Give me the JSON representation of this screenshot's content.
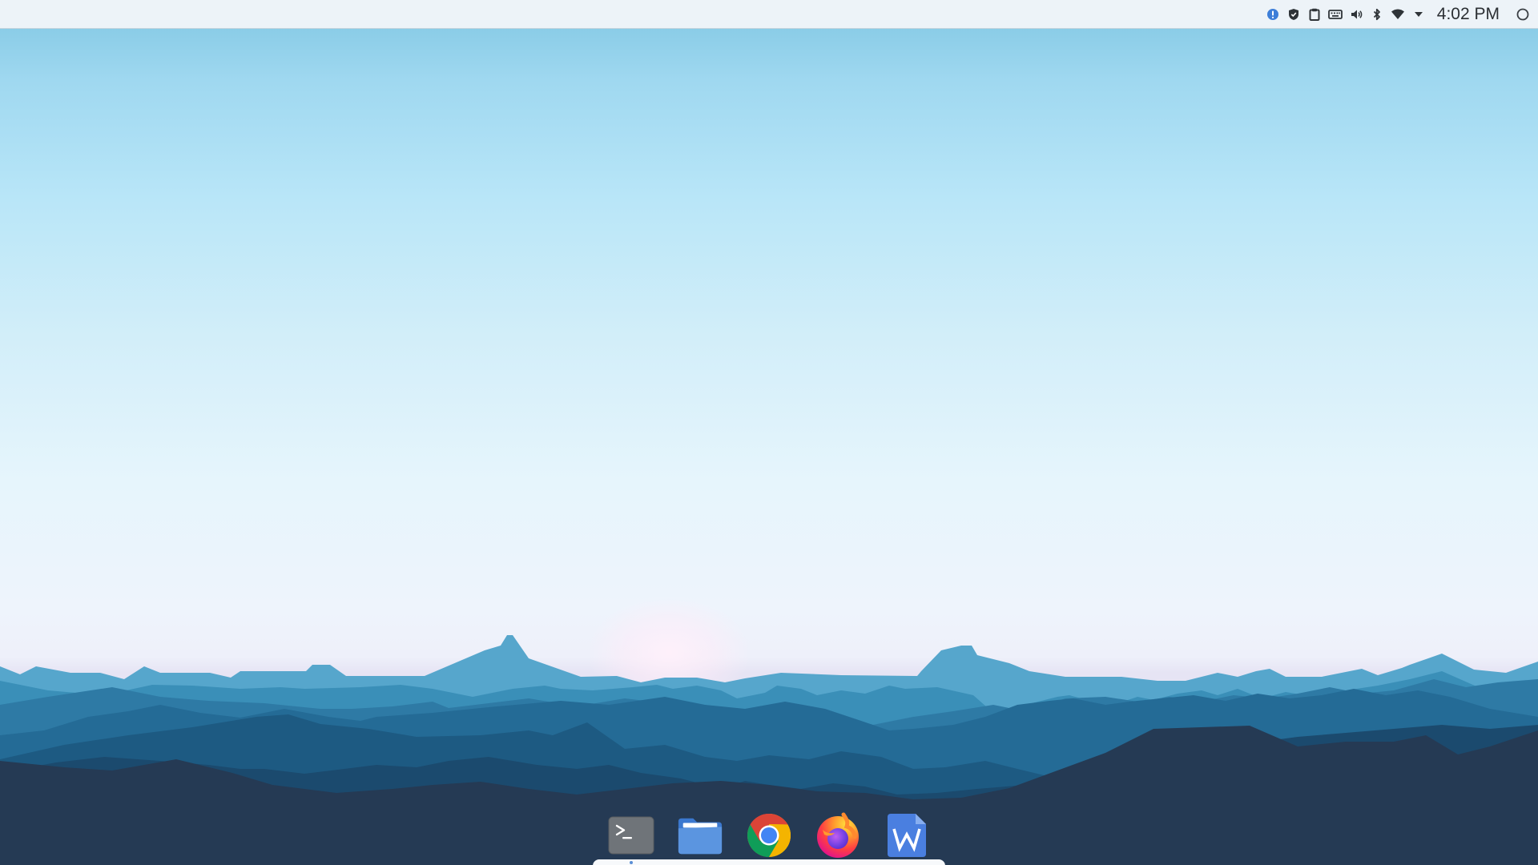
{
  "screen": {
    "name": "desktop"
  },
  "top_panel": {
    "tray_icons": [
      {
        "name": "notification-alert-icon",
        "color": "#3d7ed8"
      },
      {
        "name": "shield-icon",
        "color": "#2f3438"
      },
      {
        "name": "clipboard-icon",
        "color": "#2f3438"
      },
      {
        "name": "keyboard-icon",
        "color": "#2f3438"
      },
      {
        "name": "volume-icon",
        "color": "#2f3438"
      },
      {
        "name": "bluetooth-icon",
        "color": "#2f3438"
      },
      {
        "name": "wifi-icon",
        "color": "#2f3438"
      },
      {
        "name": "dropdown-arrow-icon",
        "color": "#2f3438"
      }
    ],
    "clock": "4:02 PM",
    "shelf_icon": "circle-icon"
  },
  "dock": {
    "apps": [
      {
        "name": "terminal",
        "icon": "terminal-icon",
        "running": true
      },
      {
        "name": "files",
        "icon": "folder-icon",
        "running": false
      },
      {
        "name": "chrome",
        "icon": "chrome-icon",
        "running": false
      },
      {
        "name": "firefox",
        "icon": "firefox-icon",
        "running": false
      },
      {
        "name": "wps-writer",
        "icon": "writer-icon",
        "running": false
      }
    ]
  },
  "colors": {
    "panel_bg": "#edf3f8",
    "sky_top": "#7fc6e2",
    "sky_bottom": "#eef0fa",
    "accent": "#3d7ed8"
  }
}
